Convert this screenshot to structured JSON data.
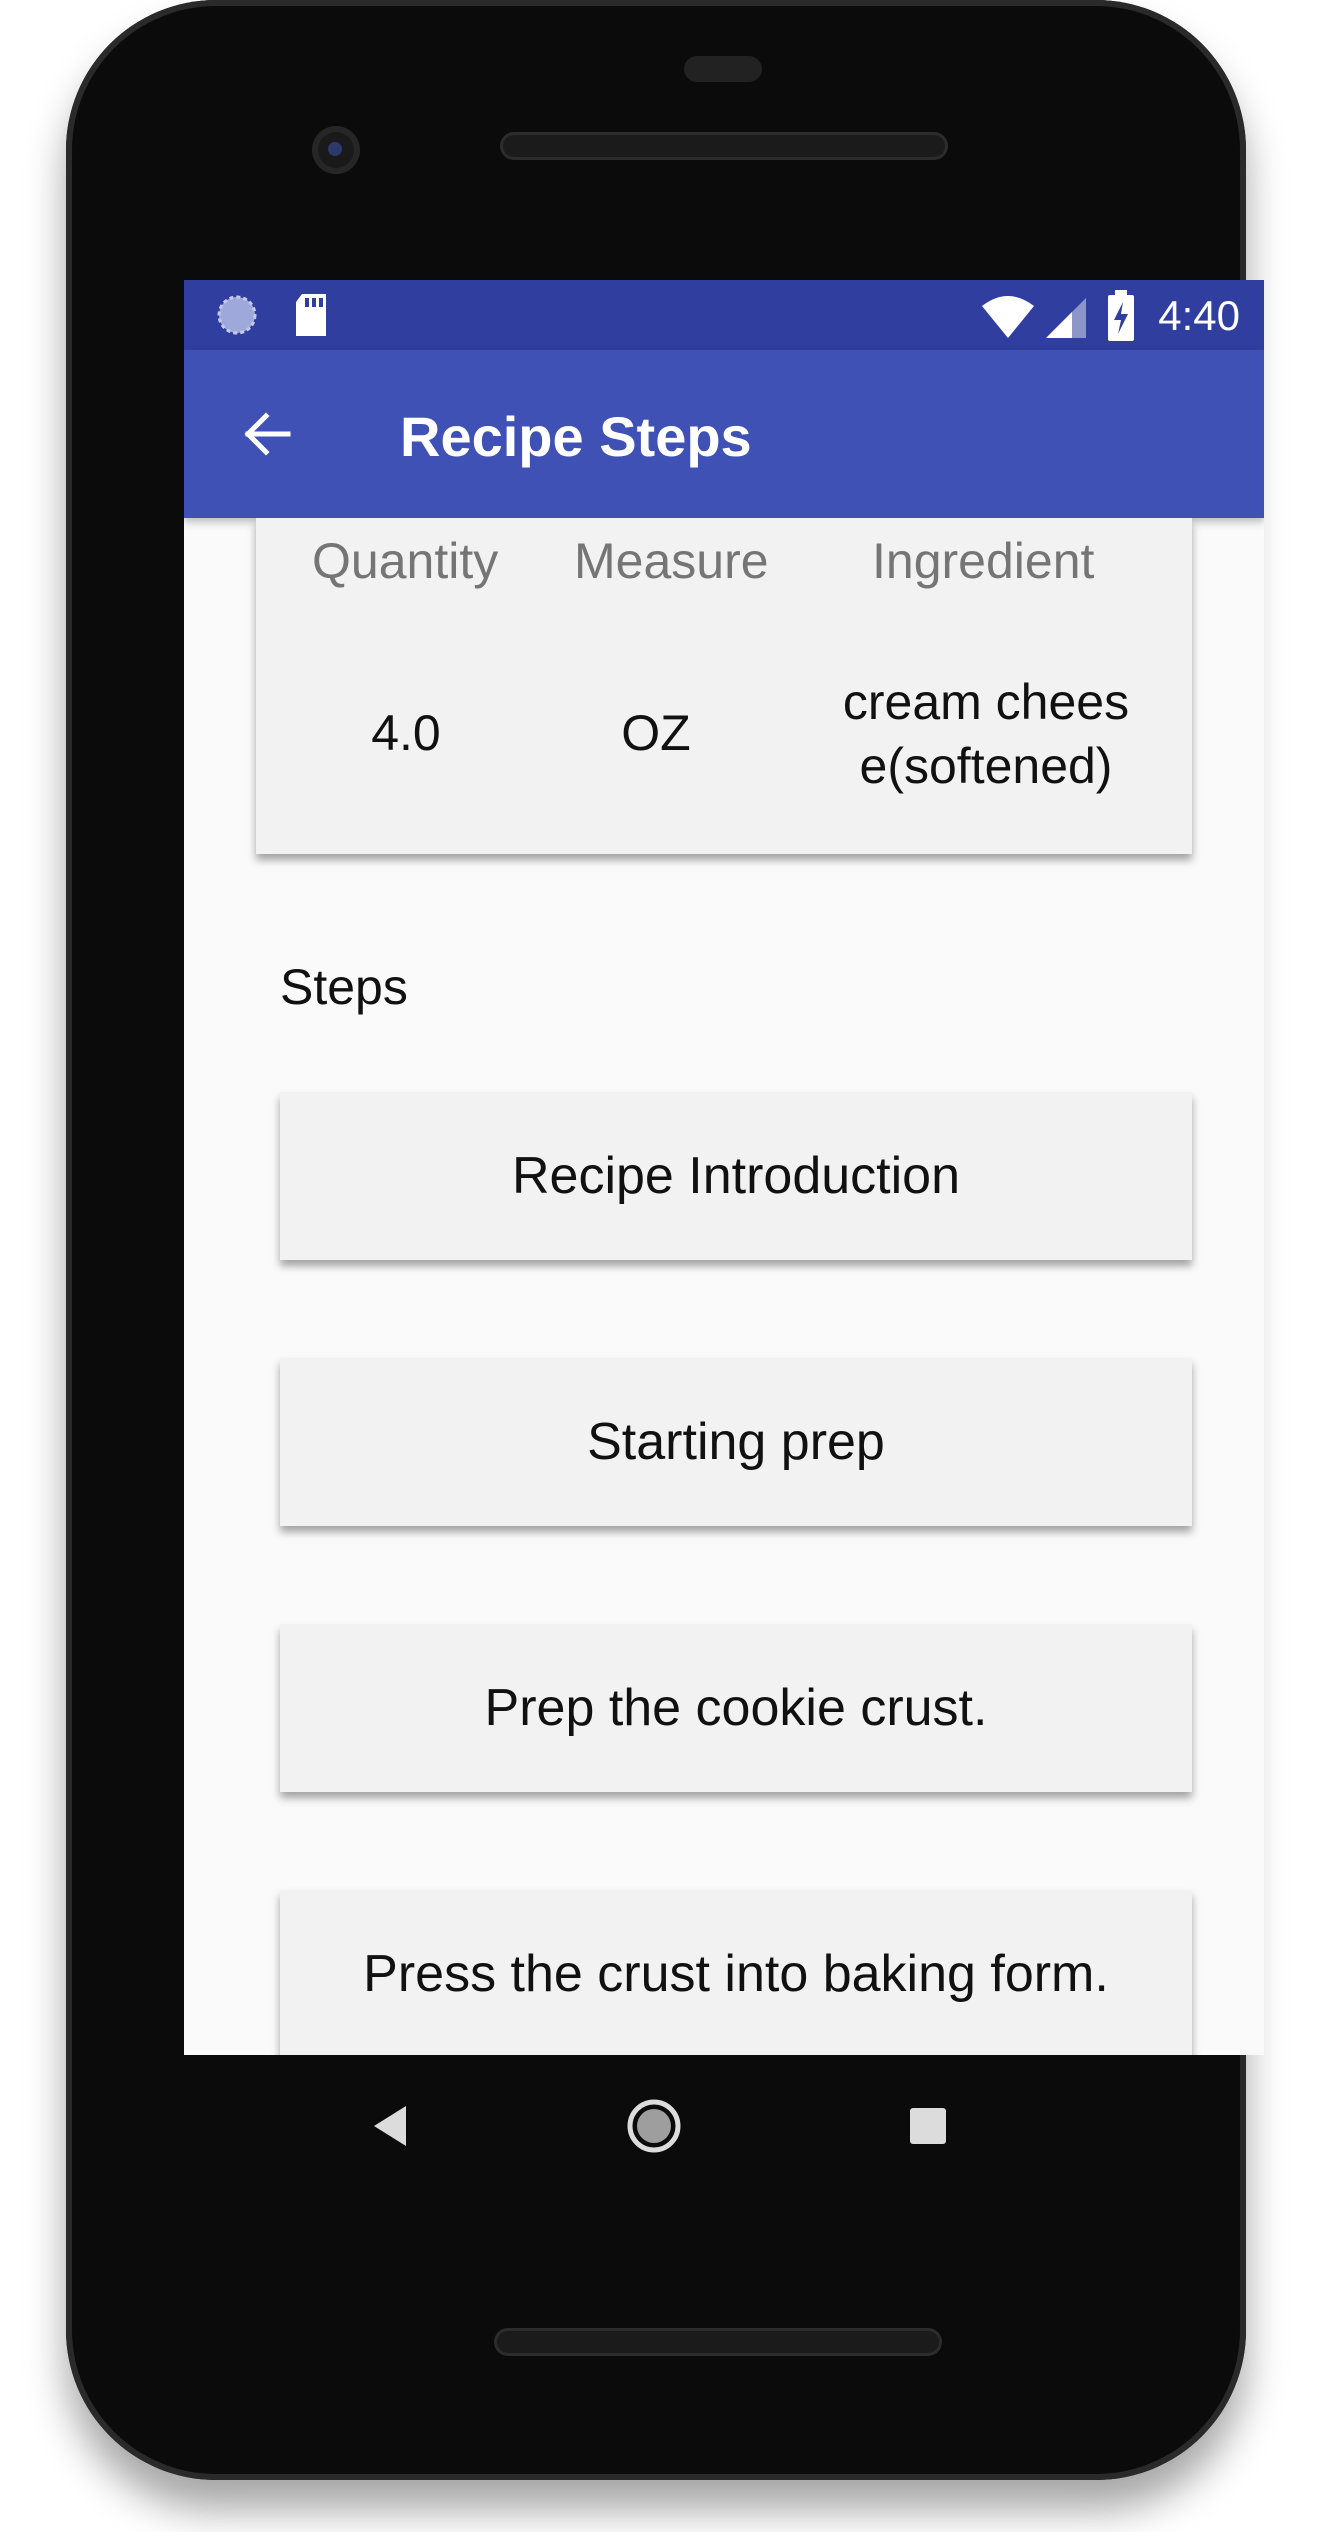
{
  "status_bar": {
    "time": "4:40",
    "icons": [
      "circle-progress-icon",
      "sd-card-icon",
      "wifi-icon",
      "signal-icon",
      "battery-charging-icon"
    ]
  },
  "app_bar": {
    "title": "Recipe Steps",
    "back_icon": "arrow-back-icon"
  },
  "ingredients": {
    "headers": [
      "Quantity",
      "Measure",
      "Ingredient"
    ],
    "row": {
      "quantity": "4.0",
      "measure": "OZ",
      "ingredient_line1": "cream chees",
      "ingredient_line2": "e(softened)"
    }
  },
  "steps": {
    "label": "Steps",
    "items": [
      "Recipe Introduction",
      "Starting prep",
      "Prep the cookie crust.",
      "Press the crust into baking form."
    ]
  },
  "nav_bar": {
    "icons": [
      "back-triangle-icon",
      "home-circle-icon",
      "recents-square-icon"
    ]
  },
  "colors": {
    "status_bar": "#303f9f",
    "app_bar": "#3f51b5",
    "card": "#f2f2f2",
    "background": "#fafafa"
  }
}
